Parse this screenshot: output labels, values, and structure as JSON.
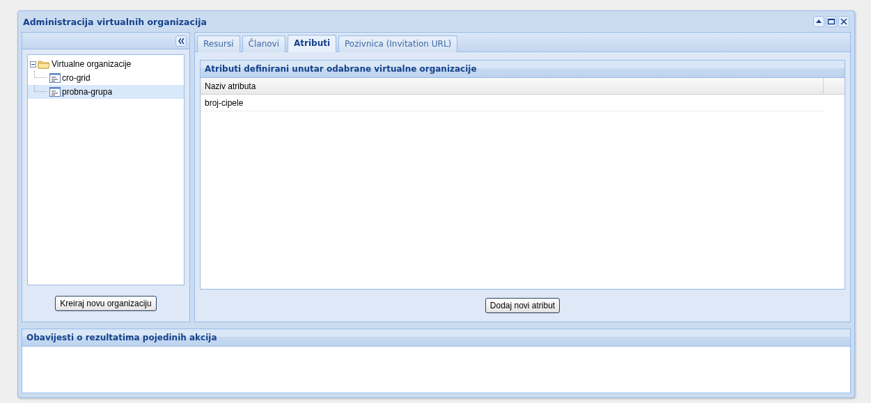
{
  "window": {
    "title": "Administracija virtualnih organizacija"
  },
  "tree": {
    "root": {
      "label": "Virtualne organizacije",
      "expanded": true,
      "children": [
        {
          "label": "cro-grid",
          "selected": false
        },
        {
          "label": "probna-grupa",
          "selected": true
        }
      ]
    },
    "create_button": "Kreiraj novu organizaciju"
  },
  "tabs": [
    {
      "label": "Resursi",
      "selected": false
    },
    {
      "label": "Članovi",
      "selected": false
    },
    {
      "label": "Atributi",
      "selected": true
    },
    {
      "label": "Pozivnica (Invitation URL)",
      "selected": false
    }
  ],
  "attributes_panel": {
    "title": "Atributi definirani unutar odabrane virtualne organizacije",
    "columns": [
      "Naziv atributa"
    ],
    "rows": [
      [
        "broj-cipele"
      ]
    ],
    "add_button": "Dodaj novi atribut"
  },
  "messages_panel": {
    "title": "Obavijesti o rezultatima pojedinih akcija"
  }
}
